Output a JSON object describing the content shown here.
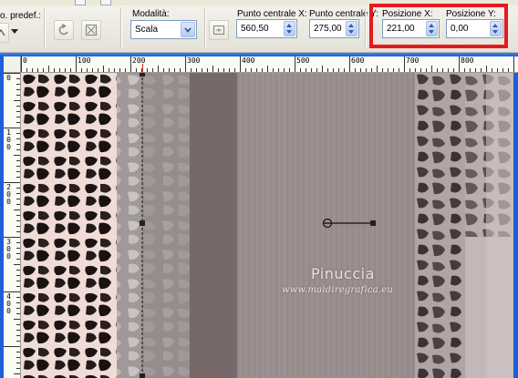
{
  "toolbar": {
    "preset_label": "o. predef.:",
    "mode_label": "Modalità:",
    "mode_value": "Scala",
    "center_x_label": "Punto centrale X:",
    "center_x_value": "560,50",
    "center_y_label": "Punto centrale Y:",
    "center_y_value": "275,00",
    "position_x_label": "Posizione X:",
    "position_x_value": "221,00",
    "position_y_label": "Posizione Y:",
    "position_y_value": "0,00"
  },
  "rulers": {
    "horizontal_labels": [
      "0",
      "100",
      "200",
      "300",
      "400",
      "500",
      "600",
      "700",
      "800"
    ],
    "vertical_labels": [
      "0",
      "1\n0\n0",
      "2\n0\n0",
      "3\n0\n0",
      "4\n0\n0"
    ]
  },
  "watermark": {
    "title": "Pinuccia",
    "url": "www.maidiregrafica.eu"
  },
  "colors": {
    "highlight": "#e6191f",
    "frame_blue": "#1d5fd6"
  }
}
